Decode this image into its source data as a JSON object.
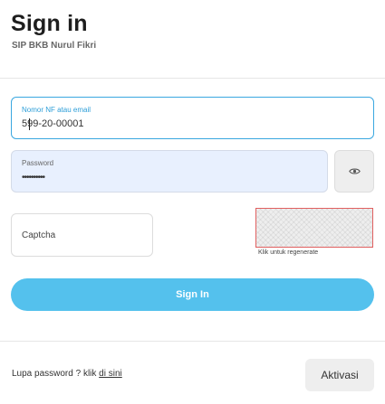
{
  "header": {
    "title": "Sign in",
    "subtitle": "SIP BKB Nurul Fikri"
  },
  "form": {
    "id_field": {
      "label": "Nomor NF atau email",
      "value": "599-20-00001"
    },
    "password_field": {
      "label": "Password",
      "value": "••••••••••"
    },
    "password_toggle_icon": "eye-icon",
    "captcha_field": {
      "placeholder": "Captcha"
    },
    "captcha_hint": "Klik untuk regenerate",
    "signin_label": "Sign In"
  },
  "footer": {
    "forgot_text": "Lupa password ? klik ",
    "forgot_link": "di sini",
    "aktivasi_label": "Aktivasi"
  },
  "colors": {
    "accent": "#54c1ed",
    "focus_border": "#3aa7e0",
    "captcha_border": "#e06060",
    "autofill_bg": "#e8f0fe"
  }
}
